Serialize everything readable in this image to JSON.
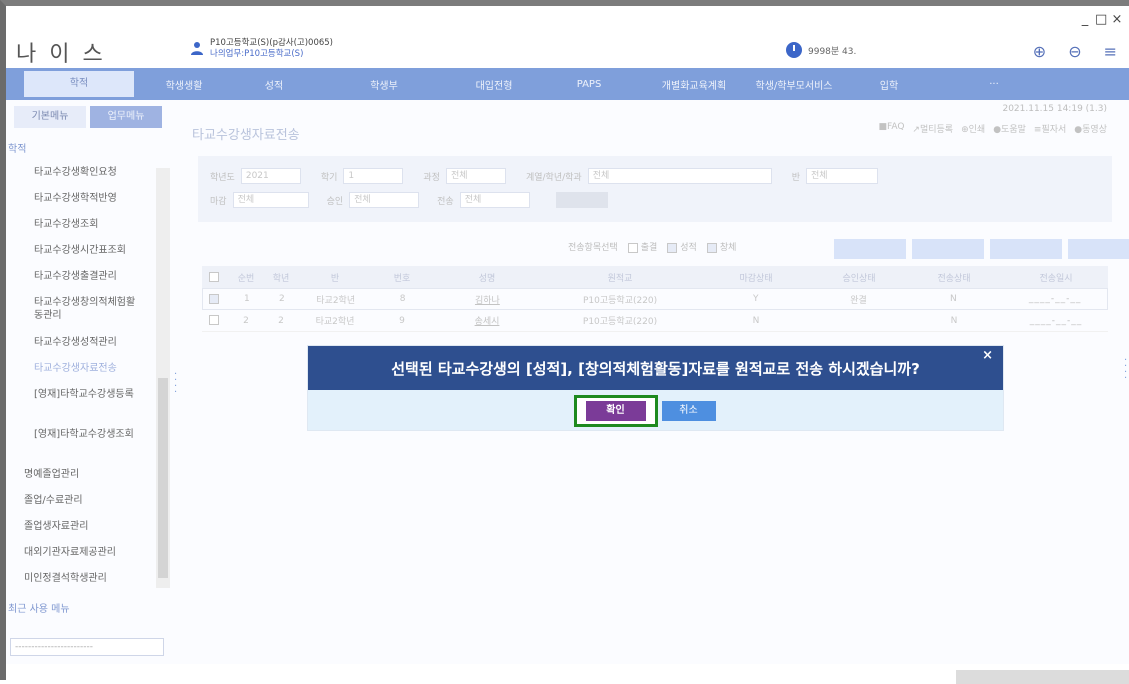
{
  "window": {
    "controls": [
      "_",
      "□",
      "×"
    ]
  },
  "header": {
    "logo": "나 이 스",
    "user_line1": "P10고등학교(S)(p감사(고)0065)",
    "user_line2": "나의업무:P10고등학교(S)",
    "timer": "9998분 43."
  },
  "nav": {
    "items": [
      "학적",
      "학생생활",
      "성적",
      "학생부",
      "대입전형",
      "PAPS",
      "개별화교육계획",
      "학생/학부모서비스",
      "입학",
      "···"
    ]
  },
  "sidebar": {
    "tab_basic": "기본메뉴",
    "tab_work": "업무메뉴",
    "section": "학적",
    "items": [
      "타교수강생확인요청",
      "타교수강생학적반영",
      "타교수강생조회",
      "타교수강생시간표조회",
      "타교수강생출결관리",
      "타교수강생창의적체험활동관리",
      "타교수강생성적관리",
      "타교수강생자료전송",
      "[영재]타학교수강생등록",
      "[영재]타학교수강생조회"
    ],
    "outer_items": [
      "명예졸업관리",
      "졸업/수료관리",
      "졸업생자료관리",
      "대외기관자료제공관리",
      "미인정결석학생관리"
    ],
    "recent": "최근 사용 메뉴",
    "recent_select": "------------------------"
  },
  "main": {
    "datetime": "2021.11.15  14:19 (1.3)",
    "title": "타교수강생자료전송",
    "tools": [
      "■FAQ",
      "↗멀티등록",
      "⊕인쇄",
      "●도움말",
      "≡필자서",
      "●동영상"
    ],
    "filter": {
      "year_label": "학년도",
      "year_value": "2021",
      "term_label": "학기",
      "term_value": "1",
      "course_label": "과정",
      "course_value": "전체",
      "dept_label": "계열/학년/학과",
      "dept_value": "전체",
      "class_label": "반",
      "class_value": "전체",
      "deadline_label": "마감",
      "deadline_value": "전체",
      "approve_label": "승인",
      "approve_value": "전체",
      "send_label": "전송",
      "send_value": "전체"
    },
    "send_options": {
      "label": "전송항목선택",
      "opt1": "출결",
      "opt2": "성적",
      "opt3": "창체"
    },
    "table": {
      "headers": [
        "",
        "순번",
        "학년",
        "반",
        "번호",
        "성명",
        "원적교",
        "마감상태",
        "승인상태",
        "전송상태",
        "전송일시"
      ],
      "rows": [
        {
          "no": "1",
          "grade": "2",
          "class": "타교2학년",
          "num": "8",
          "name": "김하나",
          "school": "P10고등학교(220)",
          "deadline": "Y",
          "approve": "완결",
          "send": "N",
          "date": "____-__-__"
        },
        {
          "no": "2",
          "grade": "2",
          "class": "타교2학년",
          "num": "9",
          "name": "송세시",
          "school": "P10고등학교(220)",
          "deadline": "N",
          "approve": "",
          "send": "N",
          "date": "____-__-__"
        }
      ]
    }
  },
  "dialog": {
    "message": "선택된 타교수강생의 [성적], [창의적체험활동]자료를 원적교로 전송 하시겠습니까?",
    "close": "×",
    "ok": "확인",
    "cancel": "취소"
  },
  "colors": {
    "nav": "#7f9fdb",
    "dialog_header": "#2e4f8f",
    "ok_button": "#7b3b98",
    "cancel_button": "#4e8fe0",
    "highlight_frame": "#1d8a1f"
  }
}
